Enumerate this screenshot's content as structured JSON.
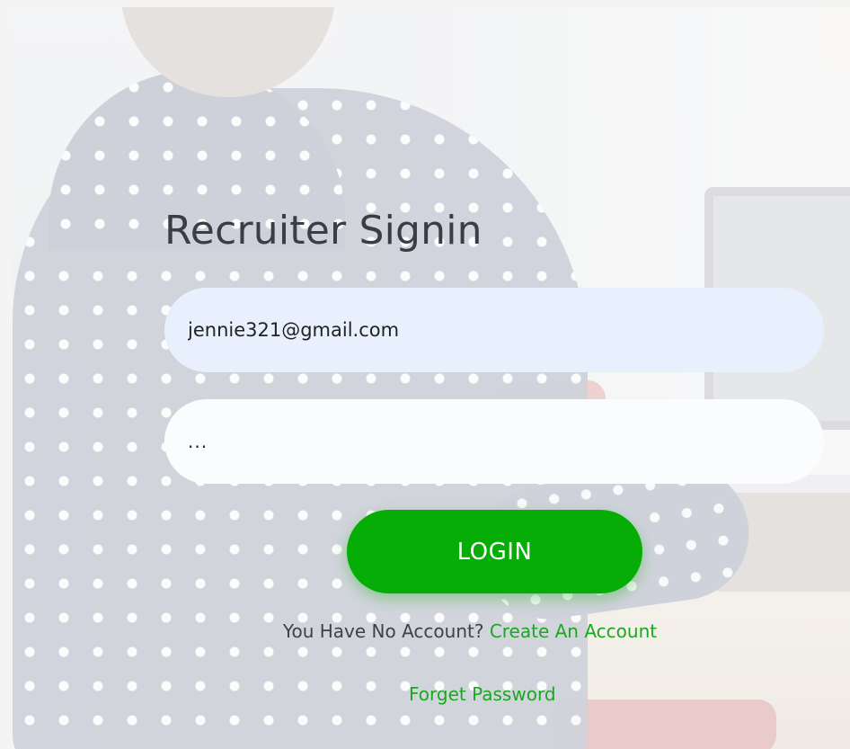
{
  "page": {
    "title": "Recruiter Signin"
  },
  "form": {
    "email_value": "jennie321@gmail.com",
    "password_value": "...",
    "login_label": "LOGIN",
    "no_account_text": "You Have No Account?",
    "create_account_label": "Create An Account",
    "forget_password_label": "Forget Password"
  },
  "colors": {
    "accent_green": "#06ad06",
    "link_green": "#19a81f",
    "email_field_bg": "#e8f0fe"
  }
}
